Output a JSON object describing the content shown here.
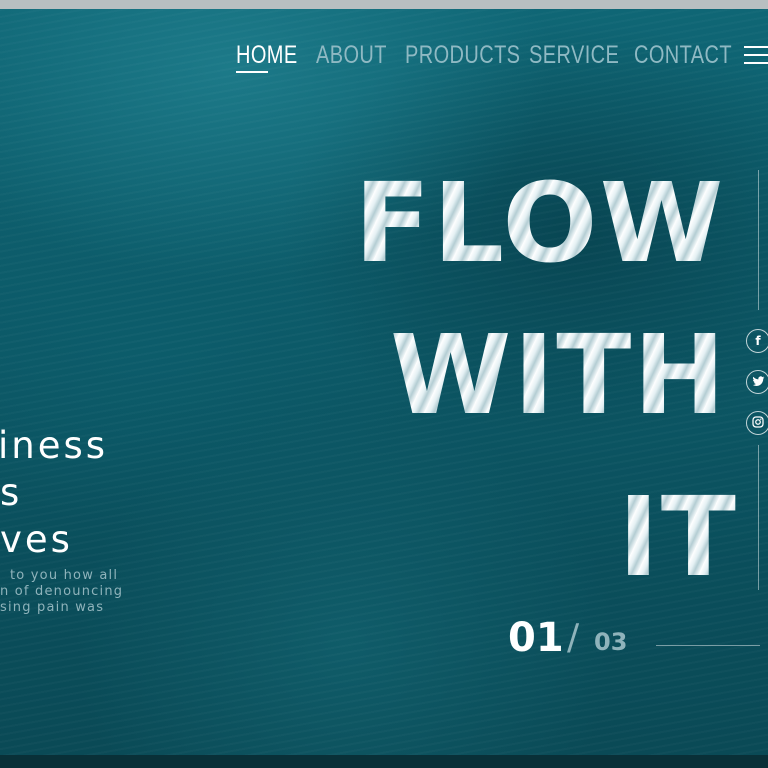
{
  "nav": {
    "items": [
      {
        "label": "HOME",
        "active": true
      },
      {
        "label": "ABOUT",
        "active": false
      },
      {
        "label": "PRODUCTS",
        "active": false
      },
      {
        "label": "SERVICE",
        "active": false
      },
      {
        "label": "CONTACT",
        "active": false
      }
    ],
    "menu_icon": "hamburger-icon"
  },
  "hero": {
    "headline_lines": [
      "FLOW",
      "WITH",
      "IT"
    ],
    "left_heading_lines": [
      "iness",
      "s",
      "ves"
    ],
    "left_text_lines": [
      "to you how all",
      "n of denouncing",
      "sing pain was"
    ]
  },
  "social": [
    {
      "icon": "facebook-icon",
      "glyph": "f"
    },
    {
      "icon": "twitter-icon"
    },
    {
      "icon": "instagram-icon"
    }
  ],
  "slider": {
    "current": "01",
    "separator": "/",
    "total": "03"
  },
  "colors": {
    "background": "#0c5866",
    "nav_inactive": "#8fb9c3",
    "nav_active": "#ffffff",
    "muted_text": "#8fb3bb"
  }
}
